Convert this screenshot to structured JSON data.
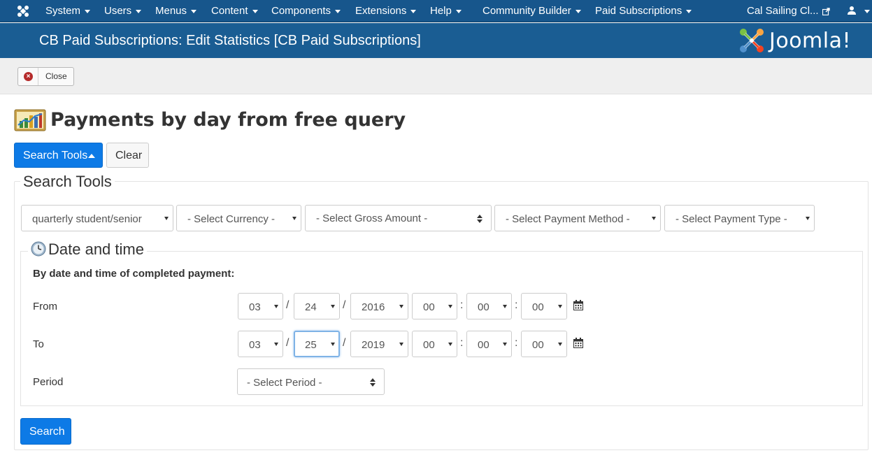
{
  "navbar": {
    "menus": [
      "System",
      "Users",
      "Menus",
      "Content",
      "Components",
      "Extensions",
      "Help",
      "Community Builder",
      "Paid Subscriptions"
    ],
    "site_link": "Cal Sailing Cl...",
    "icons": [
      "joomla-icon",
      "external-link-icon",
      "user-icon"
    ]
  },
  "header": {
    "title": "CB Paid Subscriptions: Edit Statistics [CB Paid Subscriptions]",
    "logo_text": "Joomla!",
    "background_color": "#1a5d93"
  },
  "toolbar": {
    "close_label": "Close"
  },
  "page": {
    "title": "Payments by day from free query"
  },
  "buttons": {
    "search_tools": "Search Tools",
    "clear": "Clear",
    "search": "Search",
    "primary_color": "#0d7ae6"
  },
  "search_tools": {
    "legend": "Search Tools",
    "filters": [
      "quarterly student/senior",
      "- Select Currency -",
      "- Select Gross Amount -",
      "- Select Payment Method -",
      "- Select Payment Type -"
    ]
  },
  "date_time": {
    "legend": "Date and time",
    "subheading": "By date and time of completed payment:",
    "from_label": "From",
    "to_label": "To",
    "period_label": "Period",
    "from": {
      "month": "03",
      "day": "24",
      "year": "2016",
      "hour": "00",
      "minute": "00",
      "second": "00"
    },
    "to": {
      "month": "03",
      "day": "25",
      "year": "2019",
      "hour": "00",
      "minute": "00",
      "second": "00"
    },
    "date_sep": "/",
    "time_sep": ":",
    "period": "- Select Period -"
  }
}
